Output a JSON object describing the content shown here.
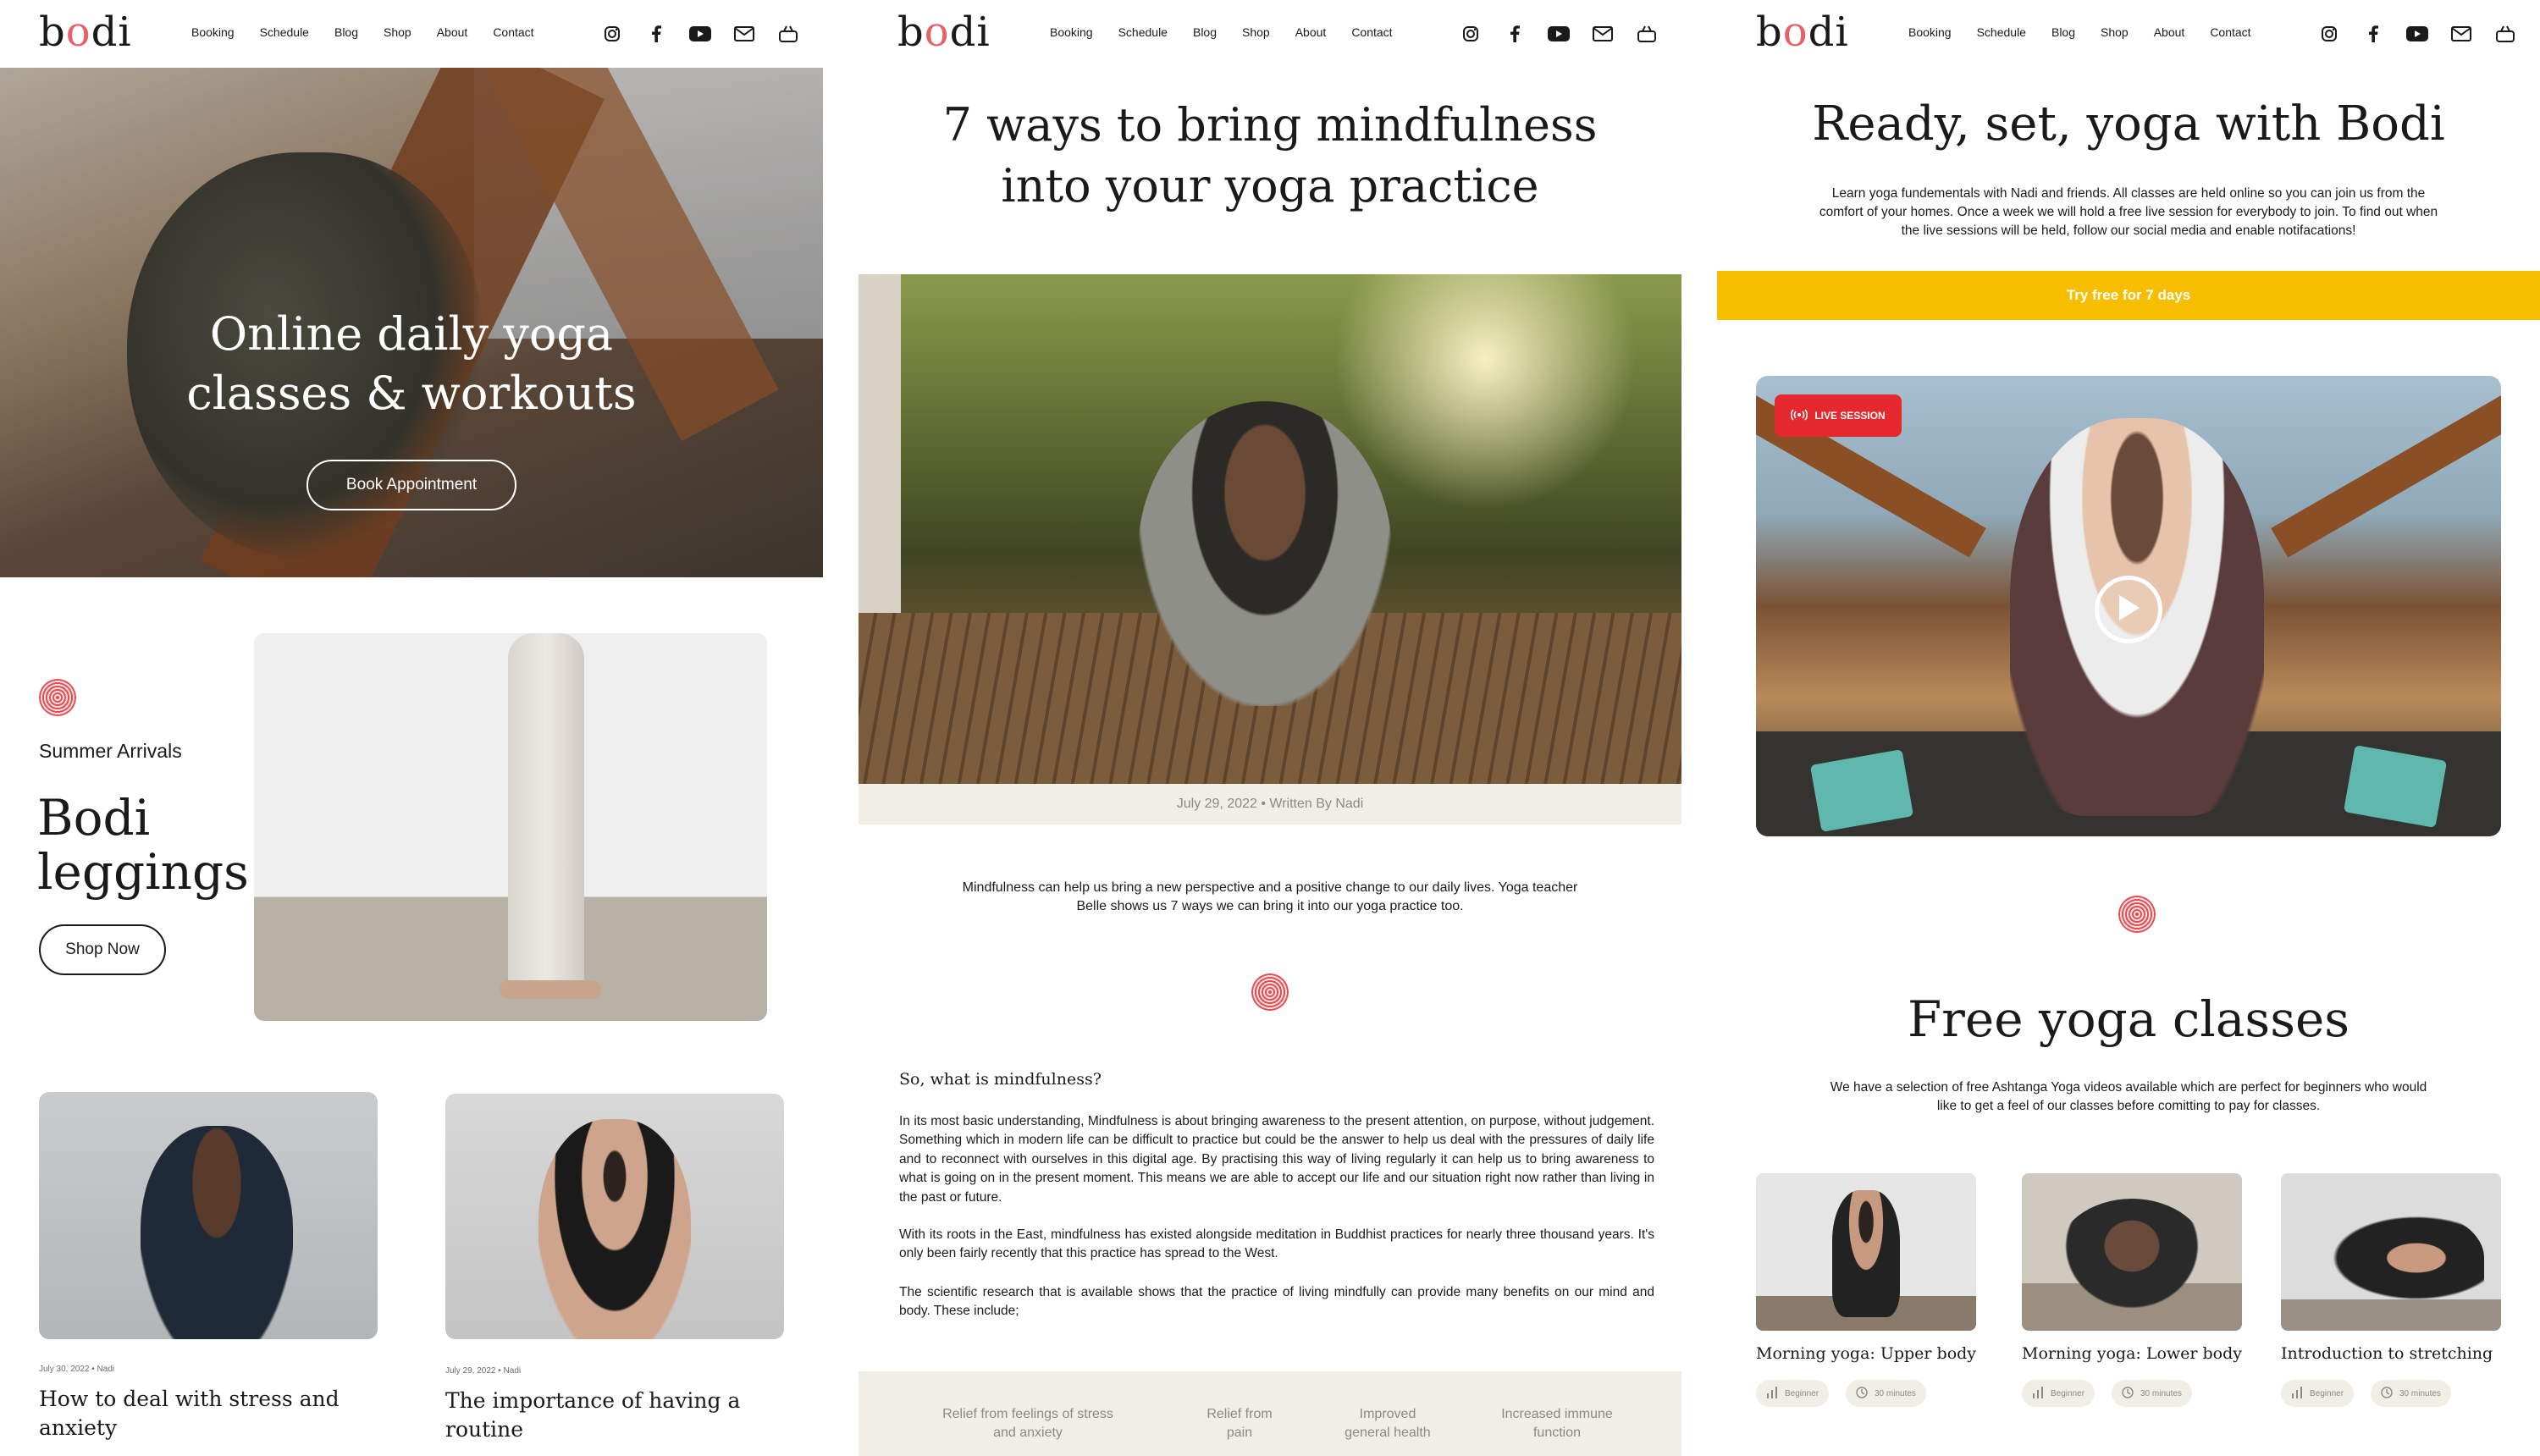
{
  "brand": {
    "logo": "bodi",
    "accent": "#e8616a",
    "cta_yellow": "#f7be00",
    "live_red": "#e5282e",
    "beige": "#f1efe5"
  },
  "nav": [
    "Booking",
    "Schedule",
    "Blog",
    "Shop",
    "About",
    "Contact"
  ],
  "header_icons": [
    "instagram-icon",
    "facebook-icon",
    "youtube-icon",
    "mail-icon",
    "basket-icon"
  ],
  "home": {
    "hero_title_line1": "Online daily yoga",
    "hero_title_line2": "classes & workouts",
    "hero_button": "Book Appointment",
    "promo_kicker": "Summer Arrivals",
    "promo_title_line1": "Bodi",
    "promo_title_line2": "leggings",
    "promo_button": "Shop Now",
    "posts": [
      {
        "meta": "July 30, 2022 • Nadi",
        "title_line1": "How to deal with stress and",
        "title_line2": "anxiety"
      },
      {
        "meta": "July 29, 2022 • Nadi",
        "title_line1": "The importance of having a",
        "title_line2": "routine"
      }
    ]
  },
  "article": {
    "title_line1": "7 ways to bring mindfulness",
    "title_line2": "into your yoga practice",
    "caption": "July 29, 2022 • Written By Nadi",
    "intro": "Mindfulness can help us bring a new perspective and a positive change to our daily lives. Yoga teacher Belle shows us 7 ways we can bring it into our yoga practice too.",
    "question": "So, what is mindfulness?",
    "paragraph1": "In its most basic understanding, Mindfulness is about bringing awareness to the present attention, on purpose, without judgement. Something which in modern life can be difficult to practice but could be the answer to help us deal with the pressures of daily life and to reconnect with ourselves in this digital age. By practising this way of living regularly it can help us to bring awareness to what is going on in the present moment. This means we are able to accept our life and our situation right now rather than living in the past or future.",
    "paragraph2": "With its roots in the East, mindfulness has existed alongside meditation in Buddhist practices for nearly three thousand years. It's only been fairly recently that this practice has spread to the West.",
    "paragraph3": "The scientific research that is available shows that the practice of living mindfully can provide many benefits on our mind and body. These include;",
    "benefits": [
      {
        "line1": "Relief from feelings of stress",
        "line2": "and anxiety"
      },
      {
        "line1": "Relief from",
        "line2": "pain"
      },
      {
        "line1": "Improved",
        "line2": "general health"
      },
      {
        "line1": "Increased immune",
        "line2": "function"
      }
    ]
  },
  "classes": {
    "title": "Ready, set, yoga with Bodi",
    "lead": "Learn yoga fundementals with Nadi and friends. All classes are held online so you can join us from the comfort of your homes. Once a week we will hold a free live session for everybody to join. To find out when the live sessions will be held, follow our social media and enable notifacations!",
    "cta": "Try free for 7 days",
    "live_badge": "LIVE SESSION",
    "free_title": "Free yoga classes",
    "free_lead": "We have a selection of free Ashtanga Yoga videos available which are perfect for beginners who would like to get a feel of our classes before comitting to pay for classes.",
    "cards": [
      {
        "title": "Morning yoga: Upper body",
        "level": "Beginner",
        "duration": "30 minutes"
      },
      {
        "title": "Morning yoga: Lower body",
        "level": "Beginner",
        "duration": "30 minutes"
      },
      {
        "title": "Introduction to stretching",
        "level": "Beginner",
        "duration": "30 minutes"
      }
    ]
  }
}
